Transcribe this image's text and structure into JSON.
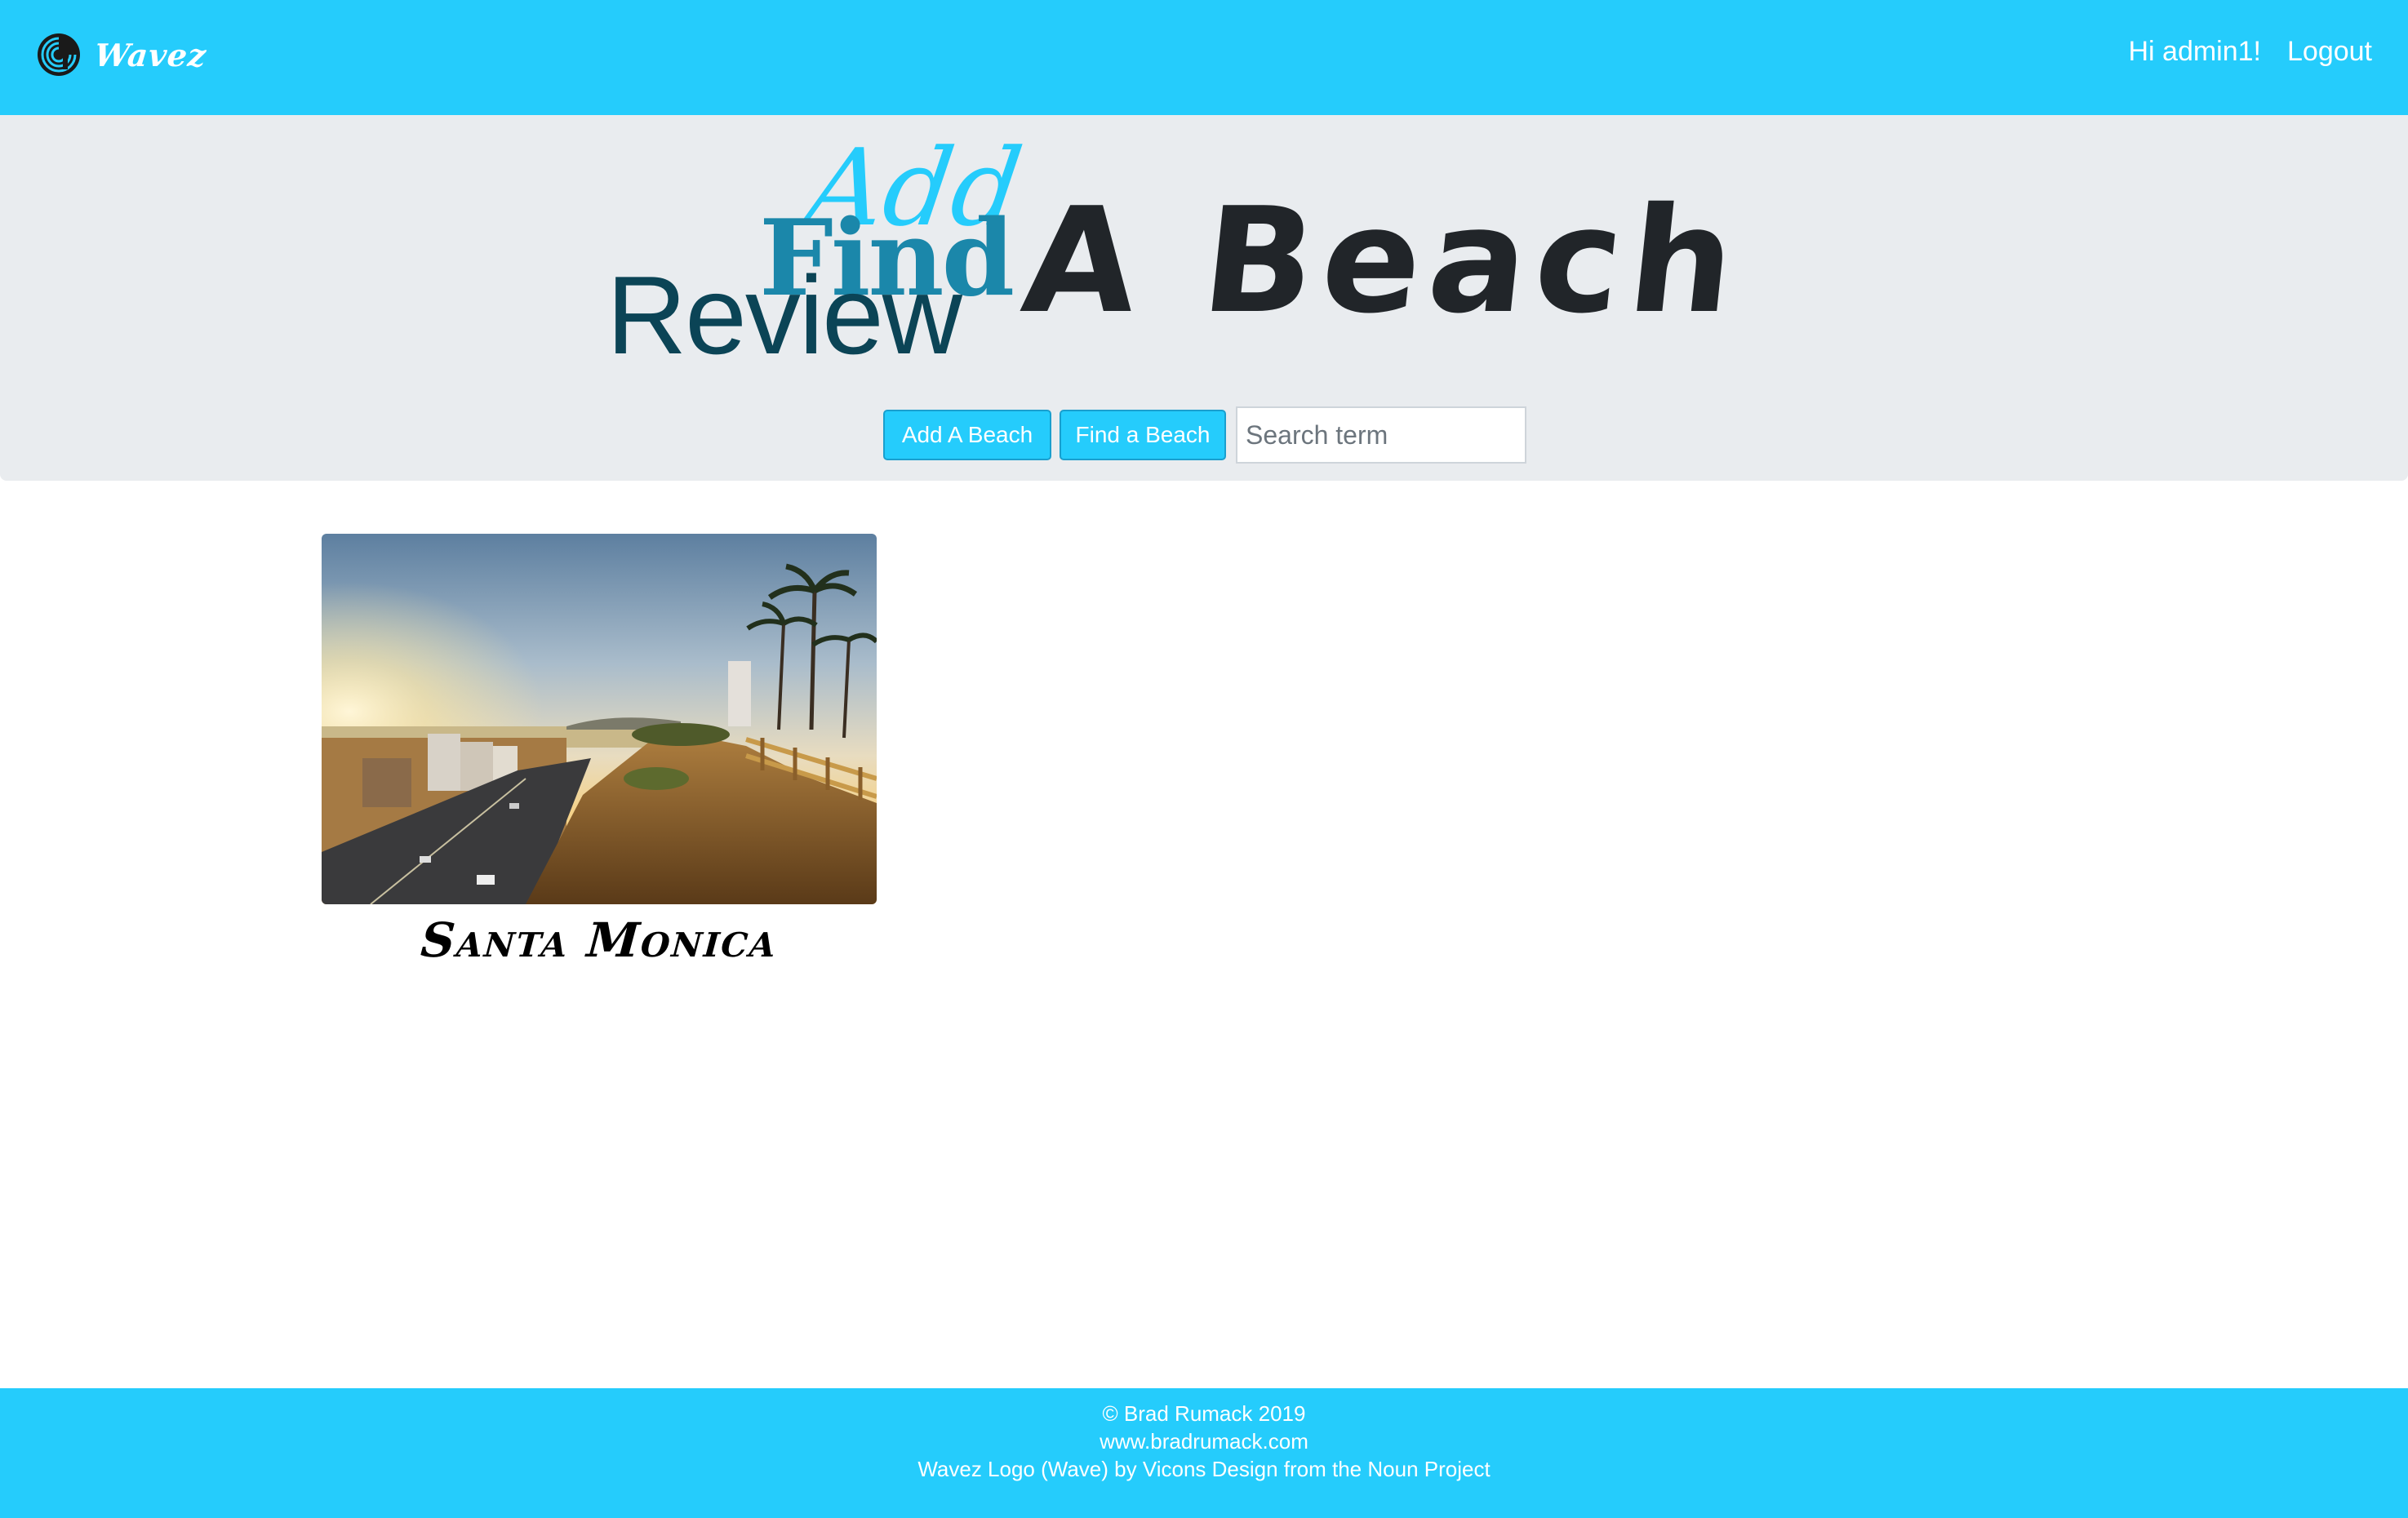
{
  "navbar": {
    "brand_name": "Wavez",
    "greeting": "Hi admin1!",
    "logout_label": "Logout"
  },
  "hero": {
    "word_add": "Add",
    "word_find": "Find",
    "word_review": "Review",
    "word_beach": "A Beach",
    "add_button_label": "Add A Beach",
    "find_button_label": "Find a Beach",
    "search_placeholder": "Search term"
  },
  "beaches": [
    {
      "name": "Santa Monica"
    }
  ],
  "footer": {
    "copyright": "© Brad Rumack 2019",
    "website": "www.bradrumack.com",
    "credit": "Wavez Logo (Wave) by Vicons Design from the Noun Project"
  },
  "colors": {
    "brand": "#25ccfc",
    "hero_background": "#e9ecef",
    "word_add": "#25ccfc",
    "word_find": "#1b87aa",
    "word_review": "#0b4456",
    "word_beach": "#212529"
  },
  "icons": {
    "brand_logo": "wave-logo-icon"
  }
}
